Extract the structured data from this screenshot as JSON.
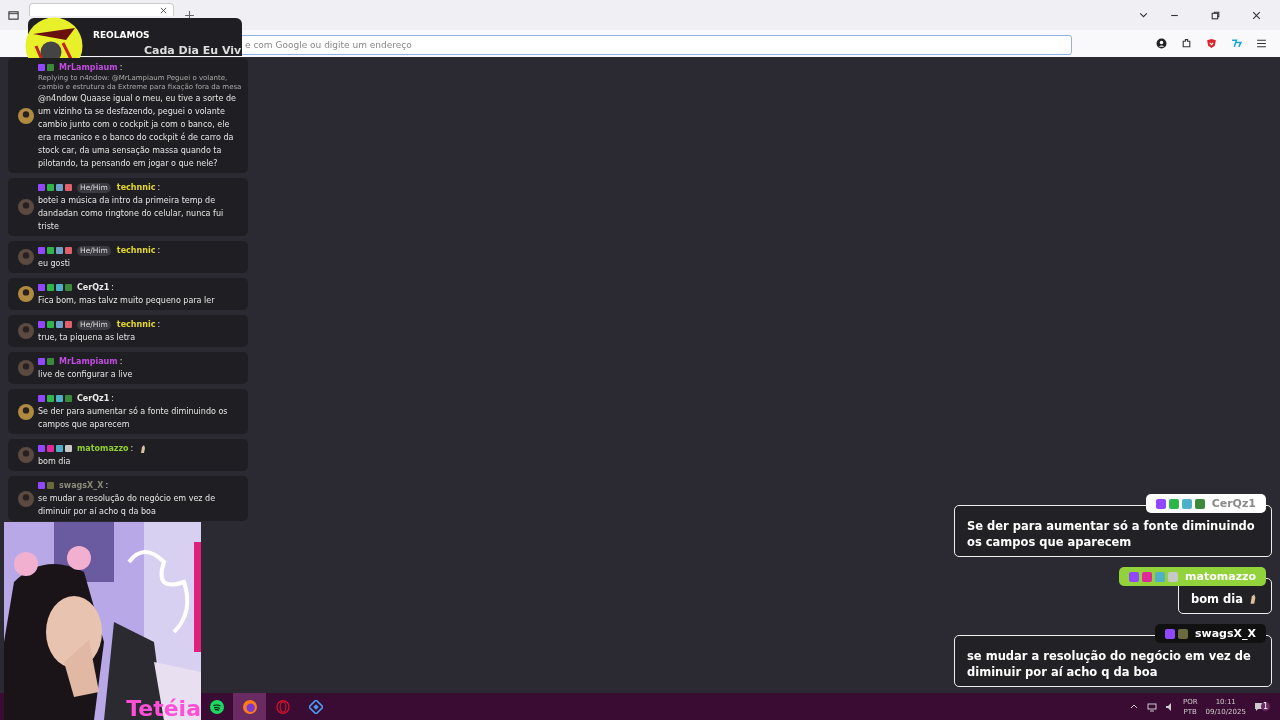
{
  "browser": {
    "address_placeholder": "e com Google ou digite um endereço"
  },
  "stream_header": {
    "title": "REOLAMOS",
    "subtitle": "Cada Dia Eu Viv"
  },
  "chat": [
    {
      "username": "MrLampiaum",
      "color": "#c04ce0",
      "badges": [
        {
          "color": "#9147ff"
        },
        {
          "color": "#3a8a3a"
        }
      ],
      "reply": "Replying to n4ndow: @MrLampiaum Peguei o volante, cambio e estrutura da Extreme para fixação fora da mesa",
      "text": "@n4ndow Quaase igual o meu, eu tive a sorte de um vizinho ta se desfazendo, peguei o volante cambio junto com o cockpit ja com o banco, ele era mecanico e o banco do cockpit é de carro da stock car, da uma sensação massa quando ta pilotando, ta pensando em jogar o que nele?",
      "separator": ":"
    },
    {
      "username": "technnic",
      "color": "#e6d92a",
      "pronoun": "He/Him",
      "badges": [
        {
          "color": "#9147ff"
        },
        {
          "color": "#2fb54a"
        },
        {
          "color": "#6fa0c8"
        },
        {
          "color": "#e0606a"
        }
      ],
      "text": "botei a música da intro da primeira temp de dandadan como ringtone do celular, nunca fui triste",
      "separator": ":"
    },
    {
      "username": "technnic",
      "color": "#e6d92a",
      "pronoun": "He/Him",
      "badges": [
        {
          "color": "#9147ff"
        },
        {
          "color": "#2fb54a"
        },
        {
          "color": "#6fa0c8"
        },
        {
          "color": "#e0606a"
        }
      ],
      "text": "eu gosti",
      "separator": ":"
    },
    {
      "username": "CerQz1",
      "color": "#e8e8e8",
      "badges": [
        {
          "color": "#9147ff"
        },
        {
          "color": "#2fb54a"
        },
        {
          "color": "#4fb0c8"
        },
        {
          "color": "#3a8a3a"
        }
      ],
      "text": "Fica bom, mas talvz muito pequeno para ler",
      "separator": ":"
    },
    {
      "username": "technnic",
      "color": "#e6d92a",
      "pronoun": "He/Him",
      "badges": [
        {
          "color": "#9147ff"
        },
        {
          "color": "#2fb54a"
        },
        {
          "color": "#6fa0c8"
        },
        {
          "color": "#e0606a"
        }
      ],
      "text": "true, ta piquena as letra",
      "separator": ":"
    },
    {
      "username": "MrLampiaum",
      "color": "#c04ce0",
      "badges": [
        {
          "color": "#9147ff"
        },
        {
          "color": "#3a8a3a"
        }
      ],
      "text": "live de configurar a live",
      "separator": ":"
    },
    {
      "username": "CerQz1",
      "color": "#e8e8e8",
      "badges": [
        {
          "color": "#9147ff"
        },
        {
          "color": "#2fb54a"
        },
        {
          "color": "#4fb0c8"
        },
        {
          "color": "#3a8a3a"
        }
      ],
      "text": "Se der para aumentar só a fonte diminuindo os campos que aparecem",
      "separator": ":"
    },
    {
      "username": "matomazzo",
      "color": "#8fd12a",
      "badges": [
        {
          "color": "#9147ff"
        },
        {
          "color": "#e02a9a"
        },
        {
          "color": "#4fb0c8"
        },
        {
          "color": "#c8c8c8"
        }
      ],
      "text": "bom dia",
      "separator": ":"
    },
    {
      "username": "swagsX_X",
      "color": "#8a8a7a",
      "badges": [
        {
          "color": "#9147ff"
        },
        {
          "color": "#6a6a40"
        }
      ],
      "text": "se mudar a resolução do negócio em vez de diminuir por aí acho q da boa",
      "separator": ":"
    }
  ],
  "webcam": {
    "name": "Tetéia"
  },
  "alerts": [
    {
      "username": "CerQz1",
      "kind": "light",
      "badges": [
        {
          "color": "#9147ff"
        },
        {
          "color": "#2fb54a"
        },
        {
          "color": "#4fb0c8"
        },
        {
          "color": "#3a8a3a"
        }
      ],
      "text": "Se der para aumentar só a fonte diminuindo os campos que aparecem",
      "emote": false
    },
    {
      "username": "matomazzo",
      "kind": "green",
      "badges": [
        {
          "color": "#9147ff"
        },
        {
          "color": "#e02a9a"
        },
        {
          "color": "#4fb0c8"
        },
        {
          "color": "#c8c8c8"
        }
      ],
      "text": "bom dia",
      "emote": true
    },
    {
      "username": "swagsX_X",
      "kind": "dark",
      "badges": [
        {
          "color": "#9147ff"
        },
        {
          "color": "#6a6a40"
        }
      ],
      "text": "se mudar a resolução do negócio em vez de diminuir por aí acho q da boa",
      "emote": false
    }
  ],
  "taskbar": {
    "apps": [
      {
        "kind": "spotify",
        "selected": false
      },
      {
        "kind": "firefox",
        "selected": true
      },
      {
        "kind": "opera",
        "selected": false
      },
      {
        "kind": "diamond",
        "selected": false
      }
    ],
    "language": "POR",
    "layout": "PTB",
    "time": "10:11",
    "date": "09/10/2025",
    "notifications": "1"
  }
}
